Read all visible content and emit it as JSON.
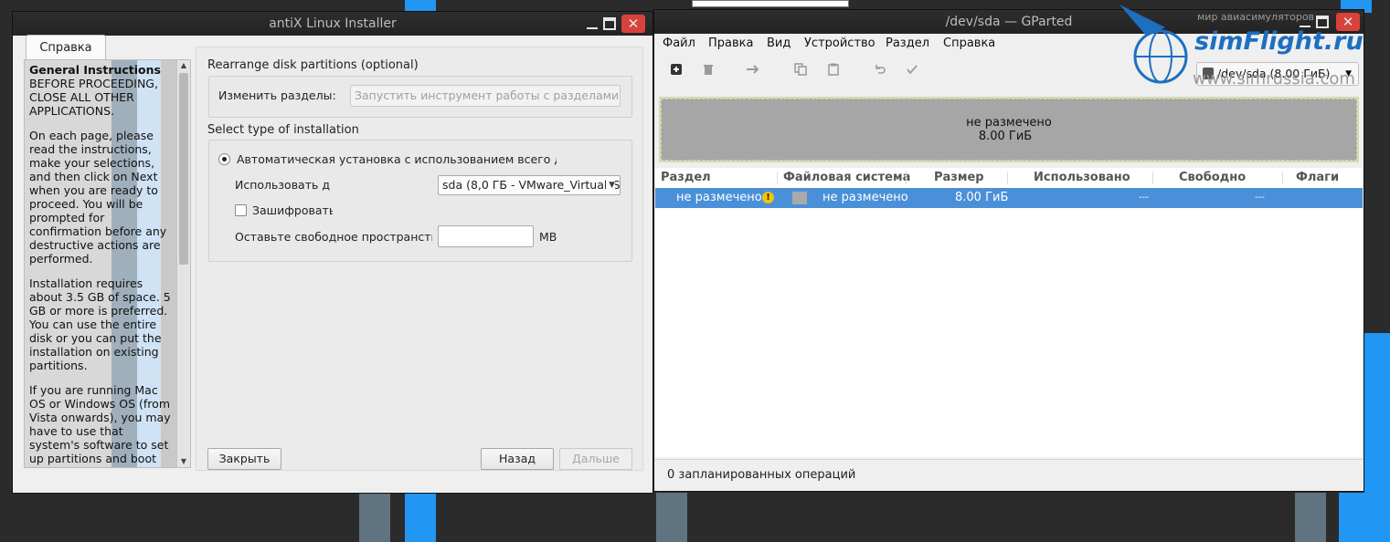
{
  "installer": {
    "title": "antiX Linux Installer",
    "window_controls": {
      "minimize": "_",
      "maximize": "",
      "close": "✕"
    },
    "help_tab": "Справка",
    "help": {
      "heading": "General Instructions",
      "p1": "BEFORE PROCEEDING, CLOSE ALL OTHER APPLICATIONS.",
      "p2": "On each page, please read the instructions, make your selections, and then click on Next when you are ready to proceed. You will be prompted for confirmation before any destructive actions are performed.",
      "p3": "Installation requires about 3.5 GB of space. 5 GB or more is preferred. You can use the entire disk or you can put the installation on existing partitions.",
      "p4": "If you are running Mac OS or Windows OS (from Vista onwards), you may have to use that system's software to set up partitions and boot manager before"
    },
    "rearrange_label": "Rearrange disk partitions (optional)",
    "edit_partitions_label": "Изменить разделы:",
    "run_partition_tool": "Запустить инструмент работы с разделами...",
    "install_type_label": "Select type of installation",
    "auto_install_label": "Автоматическая установка с использованием всего ди",
    "use_disk_label": "Использовать ди",
    "disk_select_value": "sda (8,0 ГБ - VMware_Virtual_S)",
    "encrypt_label": "Зашифровать",
    "free_space_label": "Оставьте свободное пространство",
    "free_space_unit": "MB",
    "buttons": {
      "close": "Закрыть",
      "back": "Назад",
      "next": "Дальше"
    }
  },
  "gparted": {
    "title": "/dev/sda — GParted",
    "window_controls": {
      "minimize": "_",
      "maximize": "",
      "close": "✕"
    },
    "menu": [
      "Файл",
      "Правка",
      "Вид",
      "Устройство",
      "Раздел",
      "Справка"
    ],
    "toolbar_icons": [
      "new-partition-icon",
      "delete-icon",
      "resize-move-icon",
      "copy-icon",
      "paste-icon",
      "undo-icon",
      "apply-icon"
    ],
    "device_selector": "/dev/sda (8.00 ГиБ)",
    "disk_graphic": {
      "line1": "не размечено",
      "line2": "8.00 ГиБ"
    },
    "columns": [
      "Раздел",
      "Файловая система",
      "Размер",
      "Использовано",
      "Свободно",
      "Флаги"
    ],
    "rows": [
      {
        "partition": "не размечено",
        "filesystem": "не размечено",
        "size": "8.00 ГиБ",
        "used": "---",
        "free": "---",
        "flags": ""
      }
    ],
    "status": "0 запланированных операций"
  },
  "watermark": {
    "brand": "simFlight.ru",
    "tagline": "мир авиасимуляторов",
    "url": "www.simrussia.com"
  },
  "colors": {
    "titlebar": "#2b2b2b",
    "close_button": "#d9423b",
    "selection": "#4a90d9",
    "unallocated": "#a6a6a6",
    "warning": "#f2c500",
    "watermark": "#1d6fc0"
  }
}
